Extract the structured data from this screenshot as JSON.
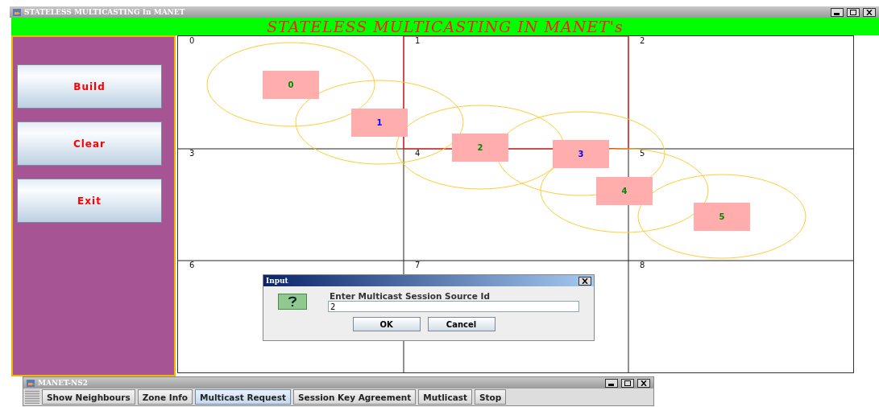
{
  "window": {
    "title": "STATELESS MULTICASTING In MANET"
  },
  "header": "STATELESS MULTICASTING IN MANET's",
  "side_buttons": [
    "Build",
    "Clear",
    "Exit"
  ],
  "cells": [
    {
      "label": "0",
      "selected": false
    },
    {
      "label": "1",
      "selected": true
    },
    {
      "label": "2",
      "selected": false
    },
    {
      "label": "3",
      "selected": false
    },
    {
      "label": "4",
      "selected": false
    },
    {
      "label": "5",
      "selected": false
    },
    {
      "label": "6",
      "selected": false
    },
    {
      "label": "7",
      "selected": false
    },
    {
      "label": "8",
      "selected": false
    }
  ],
  "nodes": [
    {
      "label": "0",
      "color": "#008a00"
    },
    {
      "label": "1",
      "color": "#0000ff"
    },
    {
      "label": "2",
      "color": "#008a00"
    },
    {
      "label": "3",
      "color": "#0000ff"
    },
    {
      "label": "4",
      "color": "#008a00"
    },
    {
      "label": "5",
      "color": "#008a00"
    }
  ],
  "dialog": {
    "title": "Input",
    "message": "Enter Multicast Session Source Id",
    "value": "2",
    "buttons": [
      "OK",
      "Cancel"
    ]
  },
  "toolbar_window": {
    "title": "MANET-NS2",
    "buttons": [
      {
        "label": "Show Neighbours",
        "selected": false
      },
      {
        "label": "Zone Info",
        "selected": false
      },
      {
        "label": "Multicast Request",
        "selected": true
      },
      {
        "label": "Session Key Agreement",
        "selected": false
      },
      {
        "label": "Mutlicast",
        "selected": false
      },
      {
        "label": "Stop",
        "selected": false
      }
    ]
  }
}
